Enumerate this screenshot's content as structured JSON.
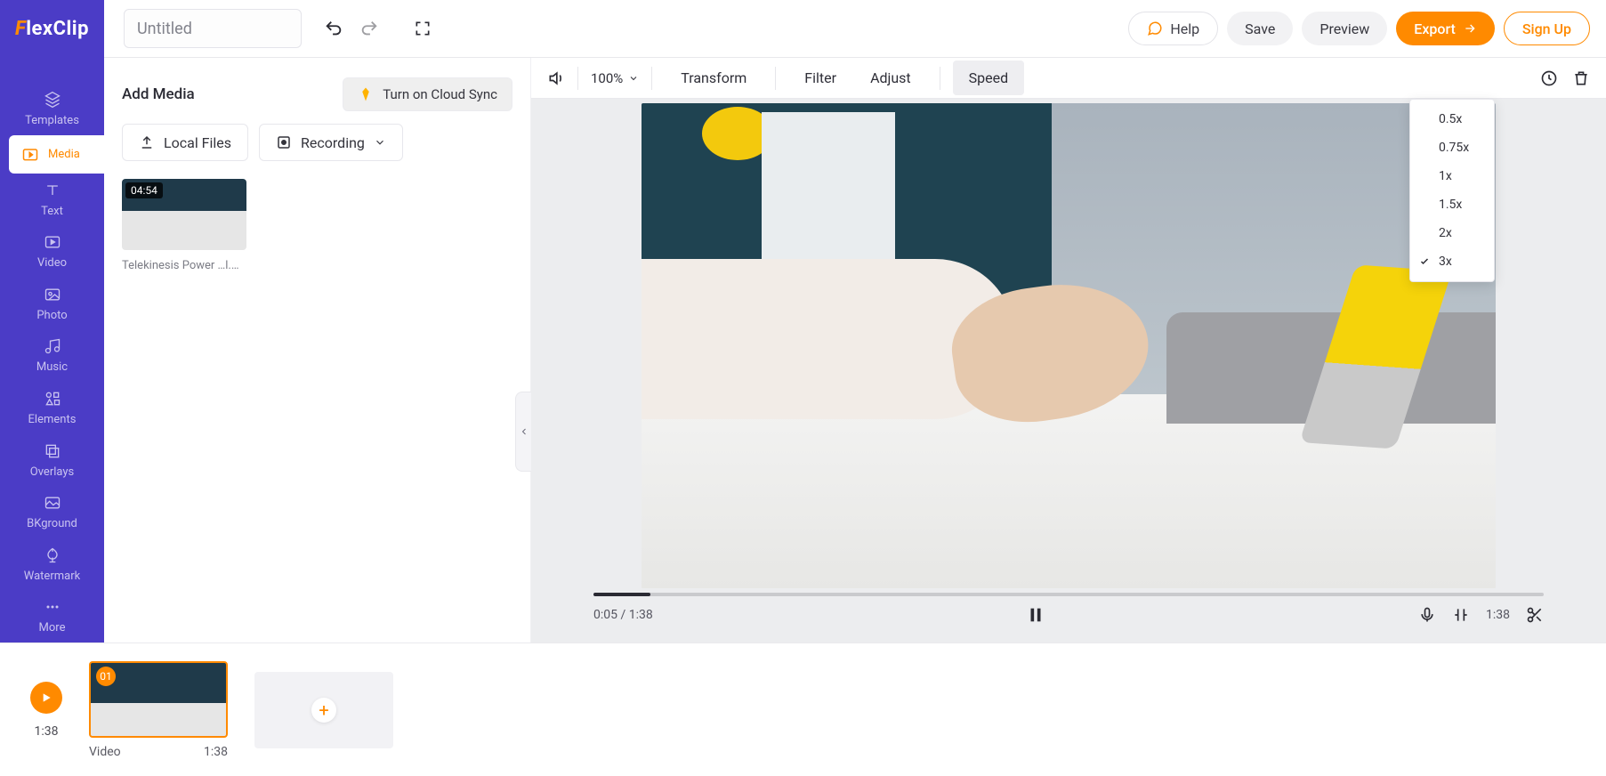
{
  "brand": {
    "name": "FlexClip"
  },
  "header": {
    "title_placeholder": "Untitled",
    "title_value": "",
    "help": "Help",
    "save": "Save",
    "preview": "Preview",
    "export": "Export",
    "signup": "Sign Up"
  },
  "sidebar": {
    "items": [
      {
        "key": "templates",
        "label": "Templates"
      },
      {
        "key": "media",
        "label": "Media"
      },
      {
        "key": "text",
        "label": "Text"
      },
      {
        "key": "video",
        "label": "Video"
      },
      {
        "key": "photo",
        "label": "Photo"
      },
      {
        "key": "music",
        "label": "Music"
      },
      {
        "key": "elements",
        "label": "Elements"
      },
      {
        "key": "overlays",
        "label": "Overlays"
      },
      {
        "key": "bkground",
        "label": "BKground"
      },
      {
        "key": "watermark",
        "label": "Watermark"
      },
      {
        "key": "more",
        "label": "More"
      }
    ],
    "active": "media"
  },
  "panel": {
    "title": "Add Media",
    "cloud_sync": "Turn on Cloud Sync",
    "local_files": "Local Files",
    "recording": "Recording",
    "media": [
      {
        "duration_badge": "04:54",
        "caption": "Telekinesis Power …l.mp4"
      }
    ]
  },
  "toolbar": {
    "zoom": "100%",
    "items": [
      "Transform",
      "Filter",
      "Adjust",
      "Speed"
    ],
    "active": "Speed"
  },
  "speed_menu": {
    "options": [
      "0.5x",
      "0.75x",
      "1x",
      "1.5x",
      "2x",
      "3x"
    ],
    "selected": "3x"
  },
  "player": {
    "current": "0:05",
    "total": "1:38",
    "progress_pct": 6,
    "clip_end": "1:38"
  },
  "timeline": {
    "play_time": "1:38",
    "clips": [
      {
        "index_badge": "01",
        "label": "Video",
        "duration": "1:38"
      }
    ]
  }
}
